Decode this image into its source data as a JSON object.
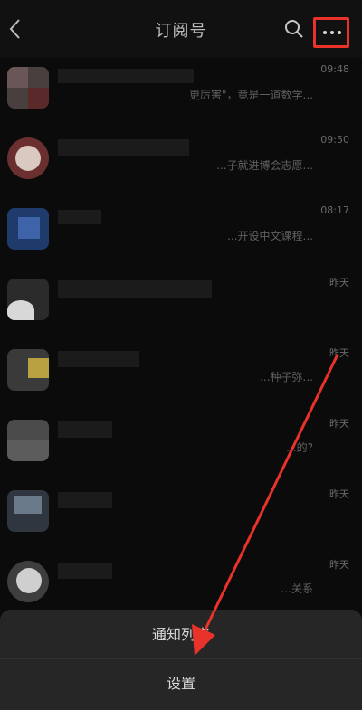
{
  "header": {
    "title": "订阅号",
    "back_icon": "chevron-left-icon",
    "search_icon": "search-icon",
    "more_icon": "more-horizontal-icon",
    "highlight_color": "#e8322a"
  },
  "list": [
    {
      "time": "09:48",
      "preview": "更厉害\"，竟是一道数学..."
    },
    {
      "time": "09:50",
      "preview": "...子就进博会志愿..."
    },
    {
      "time": "08:17",
      "preview": "...开设中文课程..."
    },
    {
      "time": "昨天",
      "preview": ""
    },
    {
      "time": "昨天",
      "preview": "...种子弥..."
    },
    {
      "time": "昨天",
      "preview": "...的?"
    },
    {
      "time": "昨天",
      "preview": ""
    },
    {
      "time": "昨天",
      "preview": "...关系"
    },
    {
      "time": "昨天",
      "preview": ""
    }
  ],
  "sheet": {
    "notify_list": "通知列表",
    "settings": "设置"
  },
  "annotation": {
    "arrow_color": "#e8322a"
  }
}
